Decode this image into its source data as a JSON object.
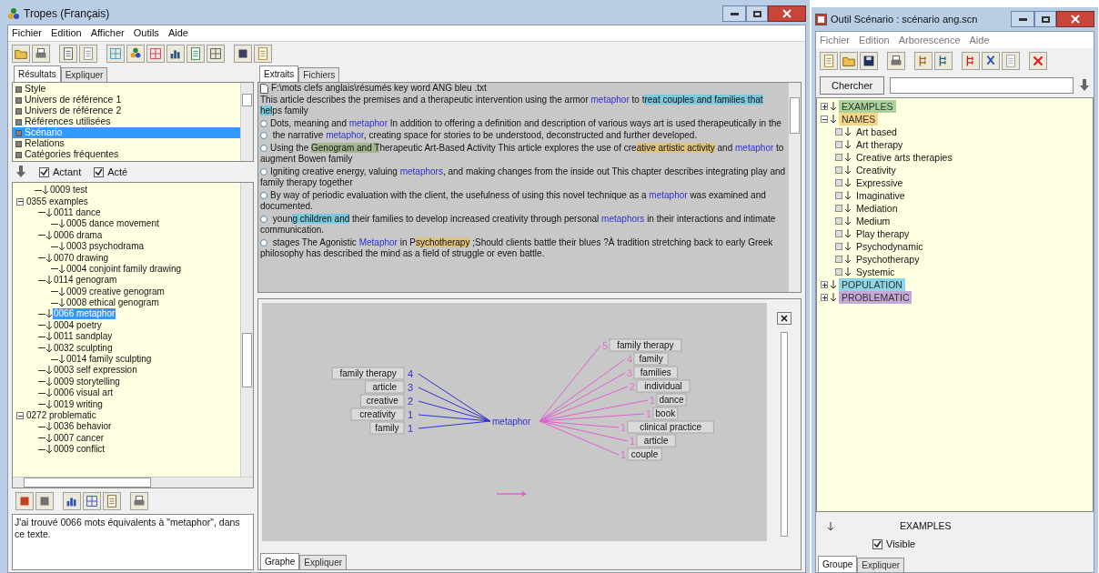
{
  "main_window": {
    "title": "Tropes (Français)",
    "menu": [
      "Fichier",
      "Edition",
      "Afficher",
      "Outils",
      "Aide"
    ]
  },
  "left_panel": {
    "tabs": [
      {
        "label": "Résultats",
        "selected": true
      },
      {
        "label": "Expliquer",
        "selected": false
      }
    ],
    "categories": [
      {
        "label": "Style",
        "selected": false
      },
      {
        "label": "Univers de référence 1",
        "selected": false
      },
      {
        "label": "Univers de référence 2",
        "selected": false
      },
      {
        "label": "Références utilisées",
        "selected": false
      },
      {
        "label": "Scénario",
        "selected": true
      },
      {
        "label": "Relations",
        "selected": false
      },
      {
        "label": "Catégories fréquentes",
        "selected": false
      }
    ],
    "checkboxes": [
      {
        "label": "Actant",
        "checked": true
      },
      {
        "label": "Acté",
        "checked": true
      }
    ],
    "tree": [
      {
        "label": "0009 test",
        "selected": false
      },
      {
        "label": "0355 examples",
        "selected": false,
        "expanded": true,
        "children": [
          {
            "label": "0011 dance",
            "selected": false,
            "children": [
              {
                "label": "0005 dance movement",
                "selected": false
              }
            ]
          },
          {
            "label": "0006 drama",
            "selected": false,
            "children": [
              {
                "label": "0003 psychodrama",
                "selected": false
              }
            ]
          },
          {
            "label": "0070 drawing",
            "selected": false,
            "children": [
              {
                "label": "0004 conjoint family drawing",
                "selected": false
              }
            ]
          },
          {
            "label": "0114 genogram",
            "selected": false,
            "children": [
              {
                "label": "0009 creative genogram",
                "selected": false
              },
              {
                "label": "0008 ethical genogram",
                "selected": false
              }
            ]
          },
          {
            "label": "0066 metaphor",
            "selected": true
          },
          {
            "label": "0004 poetry",
            "selected": false
          },
          {
            "label": "0011 sandplay",
            "selected": false
          },
          {
            "label": "0032 sculpting",
            "selected": false,
            "children": [
              {
                "label": "0014 family sculpting",
                "selected": false
              }
            ]
          },
          {
            "label": "0003 self expression",
            "selected": false
          },
          {
            "label": "0009 storytelling",
            "selected": false
          },
          {
            "label": "0006 visual art",
            "selected": false
          },
          {
            "label": "0019 writing",
            "selected": false
          }
        ]
      },
      {
        "label": "0272 problematic",
        "selected": false,
        "expanded": true,
        "children": [
          {
            "label": "0036 behavior",
            "selected": false
          },
          {
            "label": "0007 cancer",
            "selected": false
          },
          {
            "label": "0009 conflict",
            "selected": false
          }
        ]
      }
    ],
    "status_text": "J'ai trouvé 0066 mots équivalents à \"metaphor\", dans ce texte."
  },
  "extracts_panel": {
    "tabs": [
      {
        "label": "Extraits",
        "selected": true
      },
      {
        "label": "Fichiers",
        "selected": false
      }
    ],
    "file_path": "F:\\mots clefs anglais\\résumés key word ANG bleu .txt",
    "paragraphs": [
      {
        "bullet": false,
        "segments": [
          {
            "kind": "plain",
            "text": "This article describes the premises and a therapeutic intervention using the armor "
          },
          {
            "kind": "term",
            "text": "metaphor"
          },
          {
            "kind": "plain",
            "text": " to t"
          },
          {
            "kind": "mark",
            "color": "#7cc8dc",
            "text": "reat couples and families that hel"
          },
          {
            "kind": "plain",
            "text": "ps family"
          }
        ]
      },
      {
        "bullet": true,
        "segments": [
          {
            "kind": "plain",
            "text": "Dots, meaning and "
          },
          {
            "kind": "term",
            "text": "metaphor"
          },
          {
            "kind": "plain",
            "text": " In addition to offering a definition and description of various ways art is used therapeutically in the"
          }
        ]
      },
      {
        "bullet": true,
        "segments": [
          {
            "kind": "plain",
            "text": " the narrative "
          },
          {
            "kind": "term",
            "text": "metaphor"
          },
          {
            "kind": "plain",
            "text": ", creating space for stories to be understood, deconstructed and further developed."
          }
        ]
      },
      {
        "bullet": true,
        "segments": [
          {
            "kind": "plain",
            "text": "Using the "
          },
          {
            "kind": "mark",
            "color": "#a4b890",
            "text": "Genogram and T"
          },
          {
            "kind": "plain",
            "text": "herapeutic Art-Based Activity This article explores the use of cre"
          },
          {
            "kind": "mark",
            "color": "#e0c27a",
            "text": "ative artistic activity"
          },
          {
            "kind": "plain",
            "text": " and "
          },
          {
            "kind": "term",
            "text": "metaphor"
          },
          {
            "kind": "plain",
            "text": " to augment Bowen family"
          }
        ]
      },
      {
        "bullet": true,
        "segments": [
          {
            "kind": "plain",
            "text": "Igniting creative energy, valuing "
          },
          {
            "kind": "term",
            "text": "metaphors"
          },
          {
            "kind": "plain",
            "text": ", and making changes from the inside out This chapter describes integrating play and family therapy together"
          }
        ]
      },
      {
        "bullet": true,
        "segments": [
          {
            "kind": "plain",
            "text": "By way of periodic evaluation with the client, the usefulness of using this novel technique as a "
          },
          {
            "kind": "term",
            "text": "metaphor"
          },
          {
            "kind": "plain",
            "text": " was examined and documented."
          }
        ]
      },
      {
        "bullet": true,
        "segments": [
          {
            "kind": "plain",
            "text": " youn"
          },
          {
            "kind": "mark",
            "color": "#7cc8dc",
            "text": "g children and"
          },
          {
            "kind": "plain",
            "text": " their families to develop increased creativity through personal "
          },
          {
            "kind": "term",
            "text": "metaphors"
          },
          {
            "kind": "plain",
            "text": " in their interactions and intimate communication."
          }
        ]
      },
      {
        "bullet": true,
        "segments": [
          {
            "kind": "plain",
            "text": " stages The Agonistic "
          },
          {
            "kind": "term",
            "text": "Metaphor"
          },
          {
            "kind": "plain",
            "text": " in P"
          },
          {
            "kind": "mark",
            "color": "#e0c27a",
            "text": "sychotherapy"
          },
          {
            "kind": "plain",
            "text": " ;Should clients battle their blues ?À tradition stretching back to early Greek philosophy has described the mind as a field of struggle or even battle."
          }
        ]
      }
    ]
  },
  "graph_panel": {
    "center": "metaphor",
    "left_nodes": [
      {
        "label": "family therapy",
        "count": "4"
      },
      {
        "label": "article",
        "count": "3"
      },
      {
        "label": "creative",
        "count": "2"
      },
      {
        "label": "creativity",
        "count": "1"
      },
      {
        "label": "family",
        "count": "1"
      }
    ],
    "right_nodes": [
      {
        "label": "family therapy",
        "count": "5"
      },
      {
        "label": "family",
        "count": "4"
      },
      {
        "label": "families",
        "count": "3"
      },
      {
        "label": "individual",
        "count": "2"
      },
      {
        "label": "dance",
        "count": "1"
      },
      {
        "label": "book",
        "count": "1"
      },
      {
        "label": "clinical practice",
        "count": "1"
      },
      {
        "label": "article",
        "count": "1"
      },
      {
        "label": "couple",
        "count": "1"
      }
    ],
    "tabs": [
      {
        "label": "Graphe",
        "selected": true
      },
      {
        "label": "Expliquer",
        "selected": false
      }
    ]
  },
  "scenario_window": {
    "title": "Outil Scénario : scénario ang.scn",
    "menu": [
      "Fichier",
      "Edition",
      "Arborescence",
      "Aide"
    ],
    "search_button": "Chercher",
    "tree": [
      {
        "label": "EXAMPLES",
        "color": "#a8d49a",
        "expanded": false
      },
      {
        "label": "NAMES",
        "color": "#f6d68a",
        "expanded": true,
        "children": [
          {
            "label": "Art based"
          },
          {
            "label": "Art therapy"
          },
          {
            "label": "Creative arts therapies"
          },
          {
            "label": "Creativity"
          },
          {
            "label": "Expressive"
          },
          {
            "label": "Imaginative"
          },
          {
            "label": "Mediation"
          },
          {
            "label": "Medium"
          },
          {
            "label": "Play therapy"
          },
          {
            "label": "Psychodynamic"
          },
          {
            "label": "Psychotherapy"
          },
          {
            "label": "Systemic"
          }
        ]
      },
      {
        "label": "POPULATION",
        "color": "#8cd6e8",
        "expanded": false
      },
      {
        "label": "PROBLEMATIC",
        "color": "#c6a8d6",
        "expanded": false
      }
    ],
    "group_name": "EXAMPLES",
    "visible": {
      "label": "Visible",
      "checked": true
    },
    "tabs": [
      {
        "label": "Groupe",
        "selected": true
      },
      {
        "label": "Expliquer",
        "selected": false
      }
    ]
  }
}
